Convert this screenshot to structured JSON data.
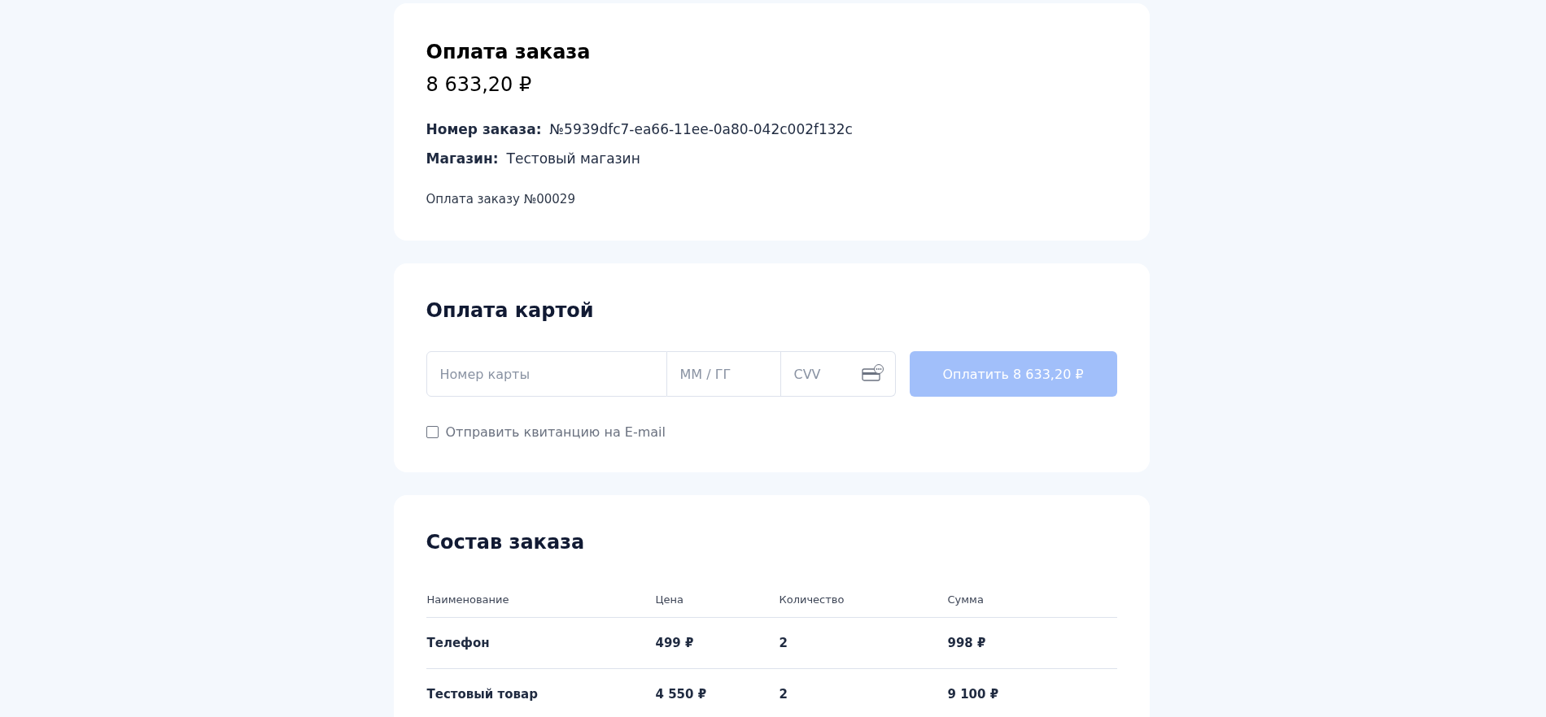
{
  "order": {
    "title": "Оплата заказа",
    "amount": "8 633,20 ₽",
    "details": [
      {
        "label": "Номер заказа:",
        "value": "№5939dfc7-ea66-11ee-0a80-042c002f132c"
      },
      {
        "label": "Магазин:",
        "value": "Тестовый магазин"
      }
    ],
    "description": "Оплата заказу №00029"
  },
  "card_payment": {
    "title": "Оплата картой",
    "card_number": {
      "placeholder": "Номер карты"
    },
    "expiry": {
      "placeholder": "MM / ГГ"
    },
    "cvv": {
      "placeholder": "CVV"
    },
    "pay_button": {
      "label": "Оплатить 8 633,20 ₽",
      "disabled": true
    },
    "email_receipt": {
      "label": "Отправить квитанцию на E-mail",
      "checked": false
    }
  },
  "order_items": {
    "title": "Состав заказа",
    "columns": [
      "Наименование",
      "Цена",
      "Количество",
      "Сумма"
    ],
    "rows": [
      [
        "Телефон",
        "499 ₽",
        "2",
        "998 ₽"
      ],
      [
        "Тестовый товар",
        "4 550 ₽",
        "2",
        "9 100 ₽"
      ]
    ]
  }
}
